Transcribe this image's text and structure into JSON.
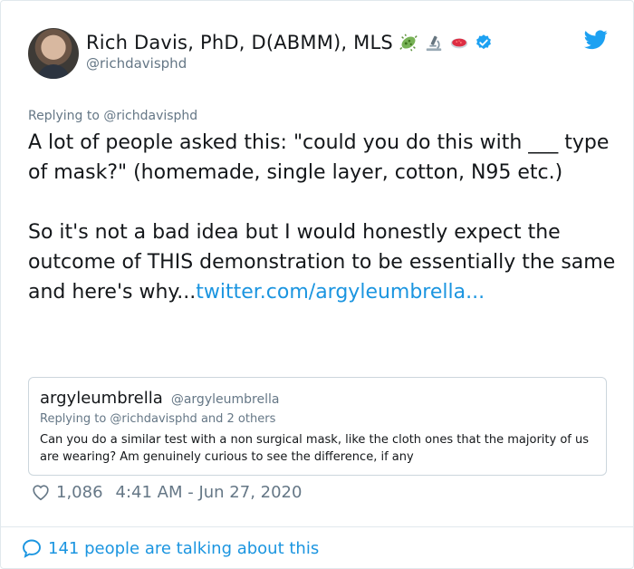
{
  "author": {
    "display_name": "Rich Davis, PhD, D(ABMM), MLS",
    "handle": "@richdavisphd",
    "emojis": [
      "microbe-emoji",
      "microscope-emoji",
      "petri-dish-emoji"
    ],
    "verified": true
  },
  "reply_context": {
    "prefix": "Replying to ",
    "handle": "@richdavisphd"
  },
  "tweet": {
    "text": "A lot of people asked this: \"could you do this with ___ type of mask?\" (homemade, single layer, cotton, N95 etc.)\n\nSo it's not a bad idea but I would honestly expect the outcome of THIS demonstration to be essentially the same and here's why...",
    "link": "twitter.com/argyleumbrella..."
  },
  "quoted_tweet": {
    "display_name": "argyleumbrella",
    "handle": "@argyleumbrella",
    "replying_to": "Replying to @richdavisphd and 2 others",
    "text": "Can you do a similar test with a non surgical mask, like the cloth ones that the majority of us are wearing? Am genuinely curious to see the difference, if any"
  },
  "meta": {
    "likes": "1,086",
    "timestamp": "4:41 AM - Jun 27, 2020"
  },
  "footer": {
    "talking": "141 people are talking about this"
  },
  "colors": {
    "link": "#1b95e0",
    "secondary_text": "#657786",
    "primary_text": "#14171a",
    "border": "#e1e8ed"
  }
}
